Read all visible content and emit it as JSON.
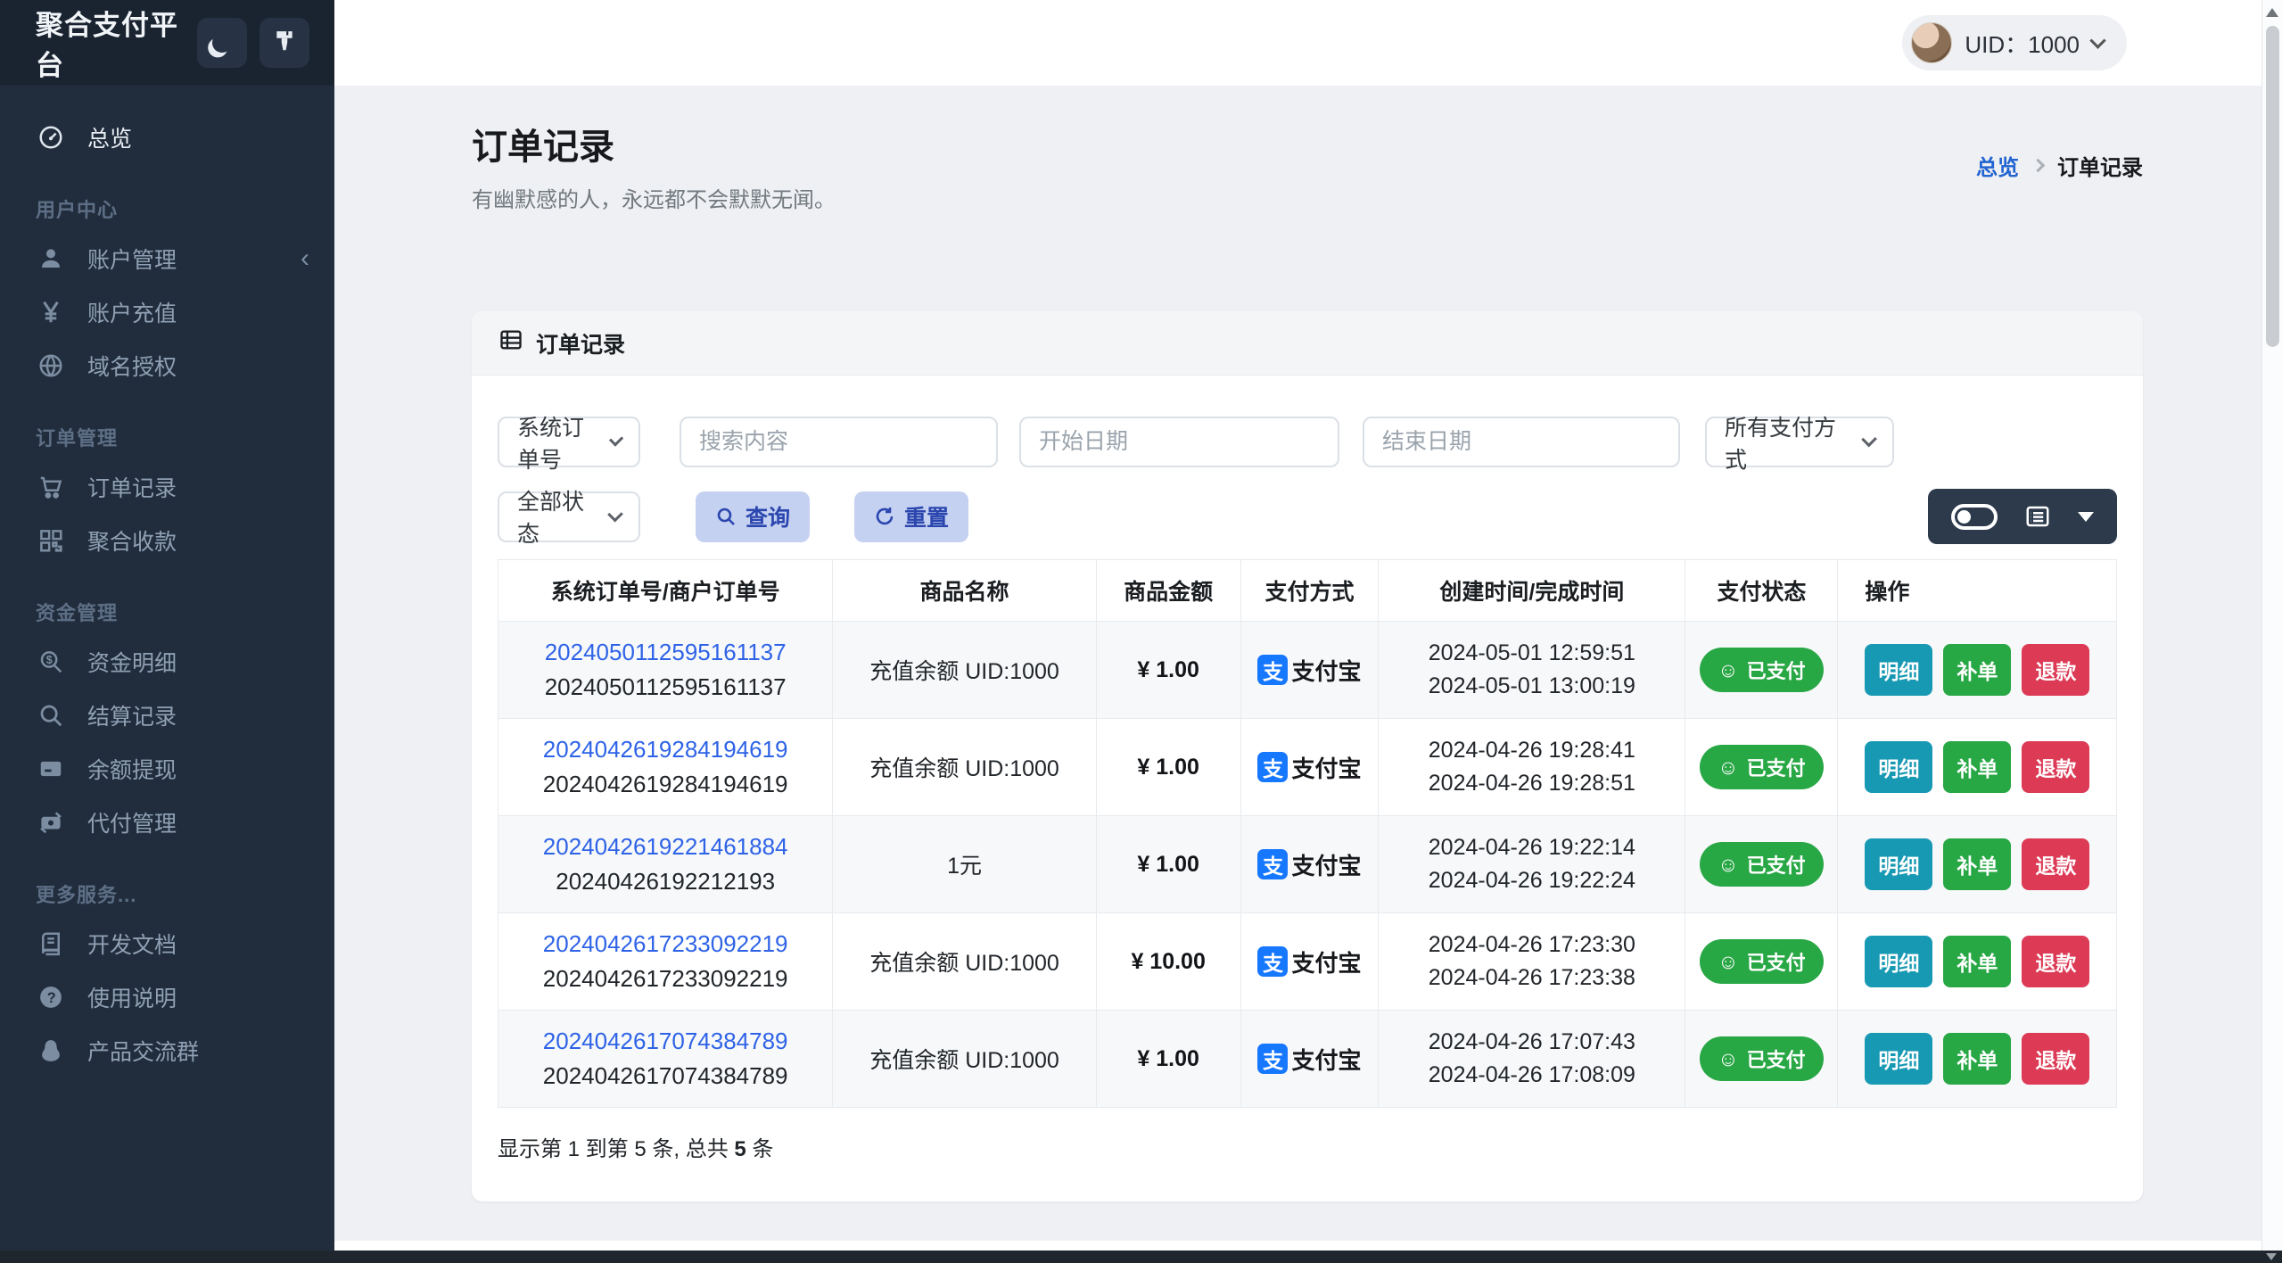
{
  "app": {
    "brand": "聚合支付平台"
  },
  "topbar": {
    "uid_label": "UID：1000"
  },
  "sidebar": {
    "sections": [
      {
        "header": null,
        "items": [
          {
            "icon": "gauge-icon",
            "label": "总览",
            "active": true
          }
        ]
      },
      {
        "header": "用户中心",
        "items": [
          {
            "icon": "user-icon",
            "label": "账户管理",
            "collapse": true
          },
          {
            "icon": "yen-icon",
            "label": "账户充值"
          },
          {
            "icon": "globe-icon",
            "label": "域名授权"
          }
        ]
      },
      {
        "header": "订单管理",
        "items": [
          {
            "icon": "cart-icon",
            "label": "订单记录"
          },
          {
            "icon": "qr-icon",
            "label": "聚合收款"
          }
        ]
      },
      {
        "header": "资金管理",
        "items": [
          {
            "icon": "fund-search-icon",
            "label": "资金明细"
          },
          {
            "icon": "search-icon",
            "label": "结算记录"
          },
          {
            "icon": "card-icon",
            "label": "余额提现"
          },
          {
            "icon": "payout-icon",
            "label": "代付管理"
          }
        ]
      },
      {
        "header": "更多服务...",
        "items": [
          {
            "icon": "doc-icon",
            "label": "开发文档"
          },
          {
            "icon": "help-icon",
            "label": "使用说明"
          },
          {
            "icon": "group-icon",
            "label": "产品交流群"
          }
        ]
      }
    ]
  },
  "page": {
    "title": "订单记录",
    "subtitle": "有幽默感的人，永远都不会默默无闻。",
    "breadcrumb_home": "总览",
    "breadcrumb_current": "订单记录"
  },
  "card": {
    "title": "订单记录"
  },
  "filters": {
    "order_type": "系统订单号",
    "search_placeholder": "搜索内容",
    "start_date_placeholder": "开始日期",
    "end_date_placeholder": "结束日期",
    "pay_method": "所有支付方式",
    "status": "全部状态",
    "query_label": "查询",
    "reset_label": "重置"
  },
  "table": {
    "columns": [
      "系统订单号/商户订单号",
      "商品名称",
      "商品金额",
      "支付方式",
      "创建时间/完成时间",
      "支付状态",
      "操作"
    ],
    "actions": [
      {
        "label": "明细",
        "type": "info"
      },
      {
        "label": "补单",
        "type": "success"
      },
      {
        "label": "退款",
        "type": "danger"
      }
    ],
    "rows": [
      {
        "sys_no": "2024050112595161137",
        "merchant_no": "2024050112595161137",
        "product": "充值余额 UID:1000",
        "amount": "¥ 1.00",
        "pay_method": "支付宝",
        "created": "2024-05-01 12:59:51",
        "finished": "2024-05-01 13:00:19",
        "status": "已支付"
      },
      {
        "sys_no": "2024042619284194619",
        "merchant_no": "2024042619284194619",
        "product": "充值余额 UID:1000",
        "amount": "¥ 1.00",
        "pay_method": "支付宝",
        "created": "2024-04-26 19:28:41",
        "finished": "2024-04-26 19:28:51",
        "status": "已支付"
      },
      {
        "sys_no": "2024042619221461884",
        "merchant_no": "20240426192212193",
        "product": "1元",
        "amount": "¥ 1.00",
        "pay_method": "支付宝",
        "created": "2024-04-26 19:22:14",
        "finished": "2024-04-26 19:22:24",
        "status": "已支付"
      },
      {
        "sys_no": "2024042617233092219",
        "merchant_no": "2024042617233092219",
        "product": "充值余额 UID:1000",
        "amount": "¥ 10.00",
        "pay_method": "支付宝",
        "created": "2024-04-26 17:23:30",
        "finished": "2024-04-26 17:23:38",
        "status": "已支付"
      },
      {
        "sys_no": "2024042617074384789",
        "merchant_no": "2024042617074384789",
        "product": "充值余额 UID:1000",
        "amount": "¥ 1.00",
        "pay_method": "支付宝",
        "created": "2024-04-26 17:07:43",
        "finished": "2024-04-26 17:08:09",
        "status": "已支付"
      }
    ],
    "footer": {
      "prefix": "显示第 1 到第 5 条, 总共 ",
      "count": "5",
      "suffix": " 条"
    }
  },
  "colors": {
    "sidebar_dark": "#212d3d",
    "accent_link_blue": "#2e63e7",
    "alipay_blue": "#1677ff",
    "status_green": "#28a745",
    "action_info_teal": "#1799b3",
    "action_success_green": "#28a745",
    "action_danger_red": "#dc3a55",
    "soft_primary_bg": "#c5d1f1",
    "soft_primary_text": "#2b46ae"
  }
}
